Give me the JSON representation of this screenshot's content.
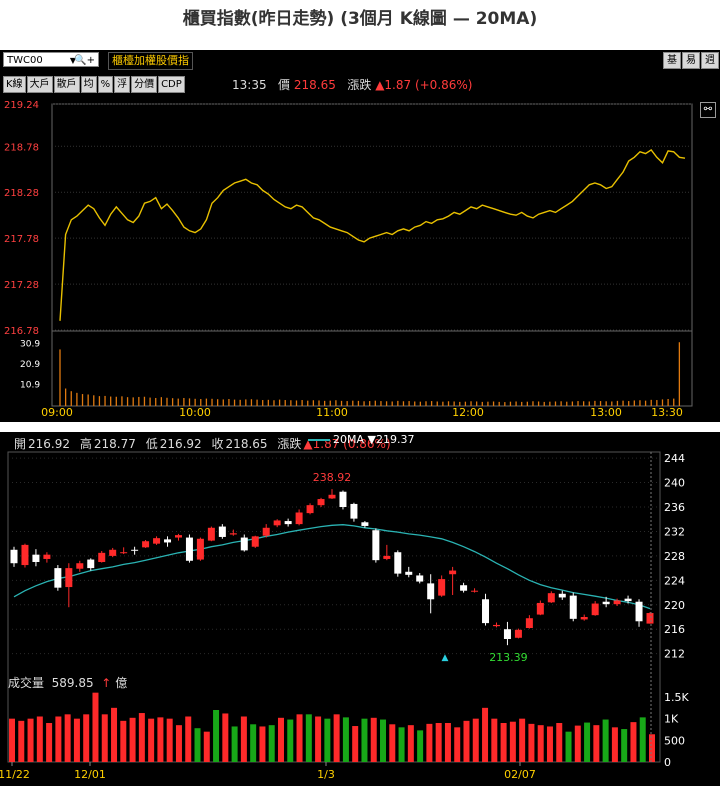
{
  "title": "櫃買指數(昨日走勢) (3個月 K線圖  — 20MA)",
  "intraday": {
    "symbol": "TWC00",
    "index_name": "櫃檯加權股價指",
    "buttons": [
      "K線",
      "大戶",
      "散戶",
      "均",
      "%",
      "浮",
      "分價",
      "CDP"
    ],
    "right_buttons": [
      "基",
      "易",
      "週"
    ],
    "time": "13:35",
    "price_label": "價",
    "price": "218.65",
    "change_label": "漲跌",
    "change": "▲1.87 (+0.86%)",
    "colors": {
      "line": "#e8c000",
      "volume": "#e07a10",
      "up": "#ff3b3b"
    },
    "icons": [
      "zoom-icon",
      "link-icon"
    ]
  },
  "daily": {
    "open_label": "開",
    "open": "216.92",
    "high_label": "高",
    "high": "218.77",
    "low_label": "低",
    "low": "216.92",
    "close_label": "收",
    "close": "218.65",
    "chg_label": "漲跌",
    "chg": "▲1.87 (0.86%)",
    "ma_label": "20MA",
    "ma_value": "▼219.37",
    "vol_label": "成交量",
    "vol_value": "589.85",
    "vol_unit": "億",
    "colors": {
      "up": "#ff2a2a",
      "down": "#ffffff",
      "ma": "#2ab3b3",
      "vol_up": "#ff2a2a",
      "vol_down": "#18a818"
    }
  },
  "chart_data": [
    {
      "type": "line",
      "y_ticks": [
        "219.24",
        "218.78",
        "218.28",
        "217.78",
        "217.28",
        "216.78"
      ],
      "vol_ticks": [
        "30.9",
        "20.9",
        "10.9"
      ],
      "x_ticks": [
        "09:00",
        "10:00",
        "11:00",
        "12:00",
        "13:00",
        "13:30"
      ],
      "ylim": [
        216.78,
        219.24
      ],
      "vol_max": 35,
      "series": [
        {
          "values": [
            216.88,
            217.82,
            217.98,
            218.02,
            218.08,
            218.14,
            218.1,
            218.0,
            217.92,
            218.04,
            218.12,
            218.05,
            217.98,
            217.95,
            218.02,
            218.16,
            218.18,
            218.22,
            218.1,
            218.15,
            218.08,
            218.0,
            217.9,
            217.86,
            217.84,
            217.88,
            217.98,
            218.16,
            218.22,
            218.3,
            218.34,
            218.38,
            218.4,
            218.42,
            218.38,
            218.36,
            218.3,
            218.26,
            218.2,
            218.16,
            218.12,
            218.1,
            218.14,
            218.12,
            218.06,
            218.0,
            217.98,
            217.94,
            217.9,
            217.88,
            217.86,
            217.84,
            217.8,
            217.76,
            217.74,
            217.78,
            217.8,
            217.82,
            217.84,
            217.82,
            217.86,
            217.88,
            217.86,
            217.9,
            217.92,
            217.96,
            217.94,
            217.98,
            217.99,
            218.02,
            218.06,
            218.04,
            218.08,
            218.12,
            218.1,
            218.14,
            218.12,
            218.1,
            218.08,
            218.06,
            218.04,
            218.03,
            218.06,
            218.02,
            218.0,
            218.04,
            218.06,
            218.08,
            218.06,
            218.1,
            218.14,
            218.18,
            218.24,
            218.3,
            218.36,
            218.38,
            218.36,
            218.32,
            218.34,
            218.42,
            218.5,
            218.62,
            218.66,
            218.72,
            218.7,
            218.74,
            218.66,
            218.6,
            218.73,
            218.72,
            218.66,
            218.65
          ]
        }
      ],
      "volume": [
        27.5,
        8.5,
        7.2,
        6.4,
        5.8,
        5.6,
        5.2,
        4.8,
        4.9,
        4.6,
        4.5,
        4.7,
        4.3,
        4.2,
        4.4,
        4.5,
        4.1,
        3.9,
        4.3,
        4.0,
        3.8,
        3.6,
        3.9,
        3.7,
        3.5,
        3.4,
        3.6,
        3.5,
        3.3,
        3.2,
        3.4,
        3.1,
        3.0,
        3.2,
        3.3,
        3.1,
        2.9,
        3.0,
        2.8,
        3.1,
        2.9,
        2.8,
        2.7,
        2.9,
        2.6,
        2.8,
        2.7,
        2.5,
        2.6,
        2.8,
        2.5,
        2.4,
        2.6,
        2.5,
        2.3,
        2.4,
        2.6,
        2.4,
        2.3,
        2.2,
        2.5,
        2.3,
        2.4,
        2.2,
        2.1,
        2.3,
        2.4,
        2.2,
        2.1,
        2.3,
        2.2,
        2.0,
        2.1,
        2.3,
        2.2,
        2.0,
        2.1,
        2.2,
        2.0,
        1.9,
        2.1,
        2.2,
        2.0,
        2.1,
        2.3,
        2.2,
        2.0,
        2.1,
        2.2,
        2.3,
        2.1,
        2.2,
        2.4,
        2.3,
        2.2,
        2.5,
        2.4,
        2.3,
        2.2,
        2.5,
        2.6,
        2.4,
        2.7,
        2.8,
        2.6,
        3.0,
        2.9,
        3.2,
        3.4,
        3.6,
        31.0
      ]
    },
    {
      "type": "candlestick",
      "y_ticks": [
        "244",
        "240",
        "236",
        "232",
        "228",
        "224",
        "220",
        "216",
        "212"
      ],
      "vol_ticks": [
        "1.5K",
        "1K",
        "500",
        "0"
      ],
      "x_ticks": [
        "11/22",
        "12/01",
        "1/3",
        "02/07"
      ],
      "ylim": [
        209,
        245
      ],
      "vol_max": 1800,
      "annotations": [
        {
          "text": "238.92",
          "value": 238.92
        },
        {
          "text": "213.39",
          "value": 213.39
        }
      ],
      "candles": [
        [
          229.0,
          229.5,
          226.2,
          226.8
        ],
        [
          226.5,
          230.0,
          226.1,
          229.8
        ],
        [
          228.2,
          229.1,
          226.3,
          227.0
        ],
        [
          227.5,
          228.6,
          226.9,
          228.2
        ],
        [
          226.0,
          226.5,
          222.3,
          222.8
        ],
        [
          222.9,
          226.8,
          219.6,
          226.0
        ],
        [
          225.9,
          227.2,
          225.4,
          226.8
        ],
        [
          227.4,
          227.6,
          225.6,
          226.0
        ],
        [
          227.0,
          228.8,
          226.9,
          228.5
        ],
        [
          228.0,
          229.3,
          227.8,
          229.0
        ],
        [
          228.6,
          229.4,
          228.3,
          228.6
        ],
        [
          229.0,
          229.5,
          228.2,
          228.9
        ],
        [
          229.4,
          230.6,
          229.3,
          230.4
        ],
        [
          230.0,
          231.2,
          229.8,
          230.9
        ],
        [
          230.7,
          231.2,
          229.5,
          230.2
        ],
        [
          231.0,
          231.6,
          230.5,
          231.4
        ],
        [
          231.0,
          231.5,
          226.9,
          227.2
        ],
        [
          227.4,
          231.0,
          227.2,
          230.8
        ],
        [
          230.5,
          232.8,
          230.4,
          232.6
        ],
        [
          232.8,
          233.2,
          230.8,
          231.1
        ],
        [
          231.5,
          232.3,
          231.3,
          231.7
        ],
        [
          231.0,
          231.5,
          228.7,
          228.9
        ],
        [
          229.5,
          231.3,
          229.3,
          231.2
        ],
        [
          231.3,
          233.2,
          231.0,
          232.6
        ],
        [
          233.0,
          234.0,
          232.7,
          233.8
        ],
        [
          233.7,
          234.1,
          232.8,
          233.2
        ],
        [
          233.2,
          235.6,
          233.0,
          235.1
        ],
        [
          235.0,
          236.6,
          234.8,
          236.3
        ],
        [
          236.3,
          237.5,
          236.0,
          237.3
        ],
        [
          237.4,
          238.92,
          237.3,
          238.0
        ],
        [
          238.5,
          238.7,
          235.6,
          236.0
        ],
        [
          236.5,
          236.7,
          233.6,
          234.1
        ],
        [
          233.5,
          233.7,
          232.6,
          232.9
        ],
        [
          232.2,
          232.5,
          226.9,
          227.3
        ],
        [
          227.5,
          229.8,
          227.3,
          228.0
        ],
        [
          228.6,
          228.9,
          224.6,
          225.1
        ],
        [
          225.4,
          226.2,
          224.5,
          224.9
        ],
        [
          224.8,
          225.2,
          223.5,
          223.8
        ],
        [
          223.5,
          225.0,
          218.6,
          220.9
        ],
        [
          221.5,
          224.8,
          221.3,
          224.2
        ],
        [
          225.0,
          226.2,
          221.6,
          225.6
        ],
        [
          223.2,
          223.6,
          222.0,
          222.3
        ],
        [
          222.3,
          222.7,
          222.0,
          222.3
        ],
        [
          220.9,
          221.8,
          216.6,
          217.0
        ],
        [
          216.5,
          217.1,
          216.3,
          216.7
        ],
        [
          216.0,
          217.2,
          213.39,
          214.4
        ],
        [
          214.6,
          216.1,
          214.5,
          215.9
        ],
        [
          216.2,
          218.3,
          216.1,
          217.8
        ],
        [
          218.4,
          220.7,
          218.3,
          220.3
        ],
        [
          220.4,
          222.2,
          220.3,
          221.9
        ],
        [
          221.8,
          222.3,
          220.8,
          221.2
        ],
        [
          221.5,
          222.0,
          217.3,
          217.7
        ],
        [
          217.6,
          218.4,
          217.4,
          218.0
        ],
        [
          218.3,
          220.6,
          218.2,
          220.2
        ],
        [
          220.5,
          221.3,
          219.6,
          220.1
        ],
        [
          220.1,
          221.0,
          219.8,
          220.7
        ],
        [
          221.0,
          221.5,
          220.2,
          220.6
        ],
        [
          220.5,
          220.9,
          216.4,
          217.3
        ],
        [
          216.92,
          218.77,
          216.92,
          218.65
        ]
      ],
      "ma20": [
        221.3,
        222.3,
        223.1,
        223.8,
        224.3,
        224.6,
        225.1,
        225.6,
        225.9,
        226.2,
        226.6,
        226.9,
        227.3,
        227.7,
        228.1,
        228.5,
        228.8,
        229.1,
        229.5,
        229.8,
        230.2,
        230.5,
        230.8,
        231.2,
        231.5,
        231.9,
        232.2,
        232.5,
        232.8,
        233.0,
        233.1,
        232.9,
        232.6,
        232.4,
        232.1,
        231.9,
        231.6,
        231.4,
        231.1,
        230.8,
        230.2,
        229.5,
        228.7,
        227.8,
        226.8,
        225.9,
        224.9,
        224.0,
        223.3,
        222.8,
        222.4,
        222.0,
        221.7,
        221.4,
        221.1,
        220.7,
        220.4,
        220.0,
        219.37
      ],
      "volume": [
        1000,
        950,
        1000,
        1050,
        900,
        1050,
        1100,
        1000,
        1100,
        1600,
        1100,
        1250,
        950,
        1020,
        1130,
        1000,
        1030,
        1000,
        850,
        1050,
        780,
        700,
        1200,
        1120,
        820,
        1050,
        870,
        820,
        850,
        1020,
        980,
        1100,
        1100,
        1050,
        1000,
        1100,
        1030,
        830,
        1000,
        1020,
        980,
        870,
        800,
        850,
        730,
        880,
        900,
        900,
        800,
        950,
        1000,
        1250,
        1000,
        900,
        930,
        1000,
        880,
        850,
        820,
        900,
        700,
        840,
        910,
        850,
        980,
        800,
        760,
        920,
        1030,
        640
      ]
    }
  ]
}
